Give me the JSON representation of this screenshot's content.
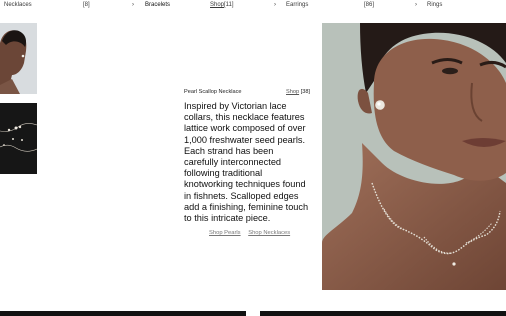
{
  "nav": {
    "necklaces": {
      "label": "Necklaces",
      "count": "[8]"
    },
    "bracelets": {
      "label": "Bracelets",
      "shop": "Shop",
      "count": "[11]"
    },
    "earrings": {
      "label": "Earrings",
      "count": "[86]"
    },
    "rings": {
      "label": "Rings"
    },
    "separator": "›"
  },
  "product": {
    "name": "Pearl Scallop Necklace",
    "shop_label": "Shop",
    "shop_count": "[38]",
    "description": "Inspired by Victorian lace collars, this necklace features lattice work composed of over 1,000 freshwater seed pearls. Each strand has been carefully interconnected following traditional knotworking techniques found in fishnets. Scalloped edges add a finishing, feminine touch to this intricate piece.",
    "links": [
      "Shop Pearls",
      "Shop Necklaces"
    ]
  },
  "colors": {
    "text": "#111111",
    "muted": "#777777",
    "dark_tile": "#161616",
    "hero_bg": "#b9c2ba"
  },
  "images": {
    "thumb1": "model-portrait-with-earring",
    "thumb2": "pearl-jewelry-on-black",
    "hero": "model-wearing-pearl-scallop-necklace"
  }
}
